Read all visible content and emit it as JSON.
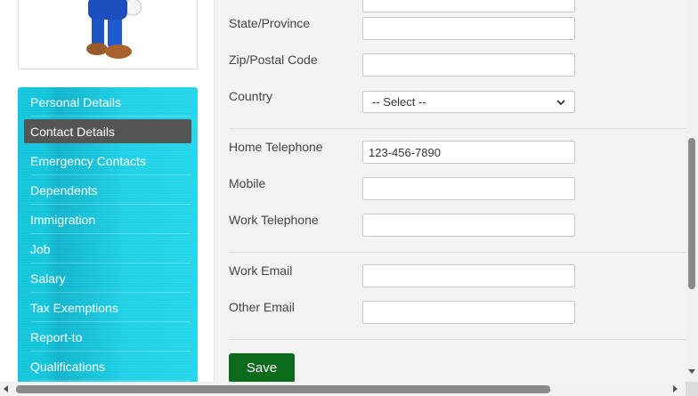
{
  "sidenav": {
    "items": [
      {
        "label": "Personal Details"
      },
      {
        "label": "Contact Details"
      },
      {
        "label": "Emergency Contacts"
      },
      {
        "label": "Dependents"
      },
      {
        "label": "Immigration"
      },
      {
        "label": "Job"
      },
      {
        "label": "Salary"
      },
      {
        "label": "Tax Exemptions"
      },
      {
        "label": "Report-to"
      },
      {
        "label": "Qualifications"
      }
    ],
    "active_index": 1
  },
  "form": {
    "state_label": "State/Province",
    "state_value": "",
    "zip_label": "Zip/Postal Code",
    "zip_value": "",
    "country_label": "Country",
    "country_selected": "-- Select --",
    "home_tel_label": "Home Telephone",
    "home_tel_value": "123-456-7890",
    "mobile_label": "Mobile",
    "mobile_value": "",
    "work_tel_label": "Work Telephone",
    "work_tel_value": "",
    "work_email_label": "Work Email",
    "work_email_value": "",
    "other_email_label": "Other Email",
    "other_email_value": "",
    "save_label": "Save"
  },
  "colors": {
    "save_button": "#0b6b1a",
    "sidenav_bg": "#13c6dd",
    "active_item": "#555555"
  }
}
